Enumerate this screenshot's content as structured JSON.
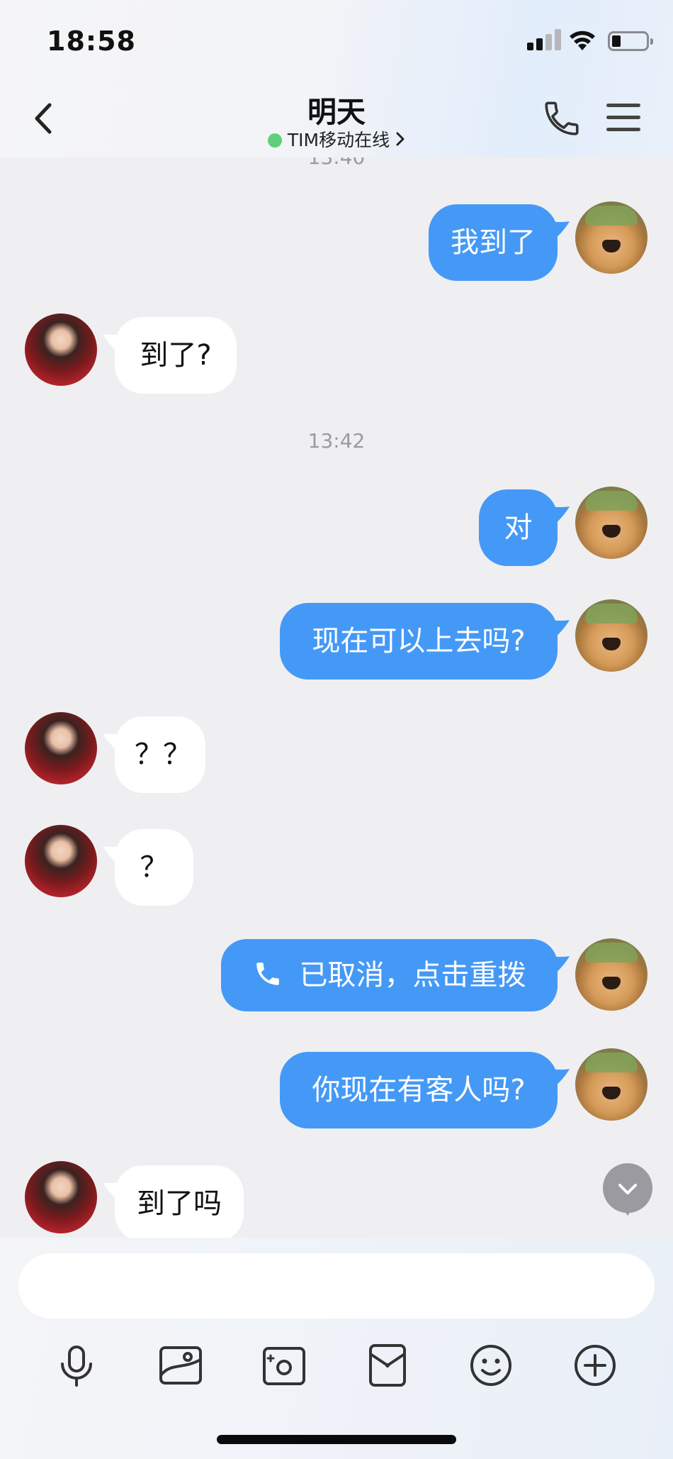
{
  "status_bar": {
    "time": "18:58"
  },
  "header": {
    "title": "明天",
    "presence": "TIM移动在线",
    "presence_color": "#5fd079"
  },
  "colors": {
    "outgoing_bubble": "#4599f6",
    "incoming_bubble": "#ffffff",
    "background": "#efeff1"
  },
  "messages": {
    "ts_partial": "13:40",
    "m1": "我到了",
    "m2": "到了?",
    "ts1": "13:42",
    "m3": "对",
    "m4": "现在可以上去吗?",
    "m5": "？？",
    "m6": "？",
    "m7": "已取消，点击重拨",
    "m8": "你现在有客人吗?",
    "m9": "到了吗"
  },
  "composer": {
    "placeholder": "",
    "tools": [
      "microphone-icon",
      "image-icon",
      "camera-icon",
      "red-packet-icon",
      "emoji-icon",
      "plus-icon"
    ]
  }
}
